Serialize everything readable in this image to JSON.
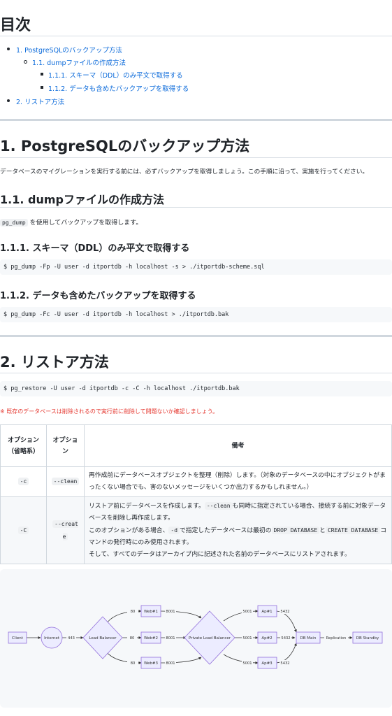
{
  "toc": {
    "title": "目次",
    "items": [
      {
        "label": "1. PostgreSQLのバックアップ方法",
        "level": 1
      },
      {
        "label": "1.1. dumpファイルの作成方法",
        "level": 2
      },
      {
        "label": "1.1.1. スキーマ（DDL）のみ平文で取得する",
        "level": 3
      },
      {
        "label": "1.1.2. データも含めたバックアップを取得する",
        "level": 3
      },
      {
        "label": "2. リストア方法",
        "level": 1
      }
    ]
  },
  "section1": {
    "title": "1. PostgreSQLのバックアップ方法",
    "intro": "データベースのマイグレーションを実行する前には、必ずバックアップを取得しましょう。この手順に沿って、実施を行ってください。",
    "sub_title": "1.1. dumpファイルの作成方法",
    "sub_code": "pg_dump",
    "sub_text": " を使用してバックアップを取得します。",
    "h3a": "1.1.1. スキーマ（DDL）のみ平文で取得する",
    "cmd_a": "$ pg_dump -Fp -U user -d itportdb -h localhost -s > ./itportdb-scheme.sql",
    "h3b": "1.1.2. データも含めたバックアップを取得する",
    "cmd_b": "$ pg_dump -Fc -U user -d itportdb -h localhost > ./itportdb.bak"
  },
  "section2": {
    "title": "2. リストア方法",
    "cmd": "$ pg_restore -U user -d itportdb -c -C -h localhost ./itportdb.bak",
    "warning": "※ 既存のデータベースは削除されるので実行前に削除して問題ないか確認しましょう。"
  },
  "table": {
    "headers": [
      "オプション（省略系）",
      "オプション",
      "備考"
    ],
    "rows": [
      {
        "short": "-c",
        "long": "--clean",
        "note": "再作成前にデータベースオブジェクトを整理（削除）します。（対象のデータベースの中にオブジェクトがまったくない場合でも、害のないメッセージをいくつか出力するかもしれません。）"
      },
      {
        "short": "-C",
        "long": "--create",
        "note_parts": {
          "p1": "リストア前にデータベースを作成します。",
          "c1": "--clean",
          "p2": "も同時に指定されている場合、接続する前に対象データベースを削除し再作成します。",
          "p3": "このオプションがある場合、",
          "c2": "-d",
          "p4": "で指定したデータベースは最初の",
          "c3": "DROP DATABASE",
          "p5": "と",
          "c4": "CREATE DATABASE",
          "p6": "コマンドの発行時にのみ使用されます。",
          "p7": "そして、すべてのデータはアーカイブ内に記述された名前のデータベースにリストアされます。"
        }
      }
    ]
  },
  "diagram": {
    "nodes": {
      "client": "Client",
      "internet": "Internet",
      "lb": "Load Balancer",
      "web1": "Web#1",
      "web2": "Web#2",
      "web3": "Web#3",
      "plb": "Private Load Balancer",
      "ap1": "Ap#1",
      "ap2": "Ap#2",
      "ap3": "Ap#3",
      "dbmain": "DB Main",
      "dbstandby": "DB Standby"
    },
    "edges": {
      "e443": "443",
      "e80a": "80",
      "e80b": "80",
      "e80c": "80",
      "e8001a": "8001",
      "e8001b": "8001",
      "e8001c": "8001",
      "e5001a": "5001",
      "e5001b": "5001",
      "e5001c": "5001",
      "e5432a": "5432",
      "e5432b": "5432",
      "e5432c": "5432",
      "replication": "Replication"
    },
    "colors": {
      "node_fill": "#ececff",
      "node_stroke": "#9370db",
      "edge": "#333333"
    }
  }
}
